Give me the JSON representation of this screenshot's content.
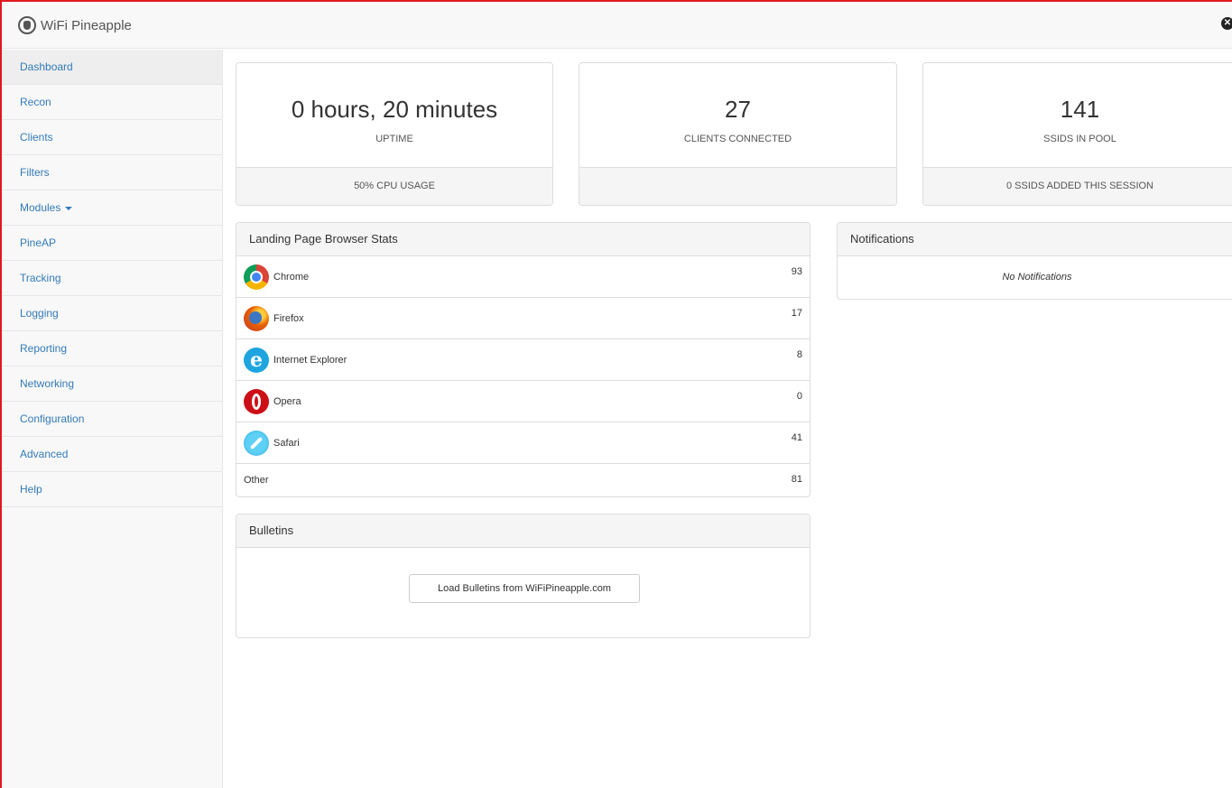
{
  "app": {
    "title": "WiFi Pineapple"
  },
  "sidebar": {
    "items": [
      {
        "label": "Dashboard"
      },
      {
        "label": "Recon"
      },
      {
        "label": "Clients"
      },
      {
        "label": "Filters"
      },
      {
        "label": "Modules"
      },
      {
        "label": "PineAP"
      },
      {
        "label": "Tracking"
      },
      {
        "label": "Logging"
      },
      {
        "label": "Reporting"
      },
      {
        "label": "Networking"
      },
      {
        "label": "Configuration"
      },
      {
        "label": "Advanced"
      },
      {
        "label": "Help"
      }
    ]
  },
  "stats": {
    "uptime": {
      "value": "0 hours, 20 minutes",
      "label": "UPTIME",
      "footer": "50% CPU USAGE"
    },
    "clients": {
      "value": "27",
      "label": "CLIENTS CONNECTED",
      "footer": ""
    },
    "ssids": {
      "value": "141",
      "label": "SSIDS IN POOL",
      "footer": "0 SSIDS ADDED THIS SESSION"
    }
  },
  "browser_stats": {
    "title": "Landing Page Browser Stats",
    "rows": [
      {
        "name": "Chrome",
        "count": "93"
      },
      {
        "name": "Firefox",
        "count": "17"
      },
      {
        "name": "Internet Explorer",
        "count": "8"
      },
      {
        "name": "Opera",
        "count": "0"
      },
      {
        "name": "Safari",
        "count": "41"
      },
      {
        "name": "Other",
        "count": "81"
      }
    ]
  },
  "bulletins": {
    "title": "Bulletins",
    "button": "Load Bulletins from WiFiPineapple.com"
  },
  "notifications": {
    "title": "Notifications",
    "empty": "No Notifications"
  },
  "colors": {
    "accent": "#e0191f",
    "link": "#337ab7"
  }
}
